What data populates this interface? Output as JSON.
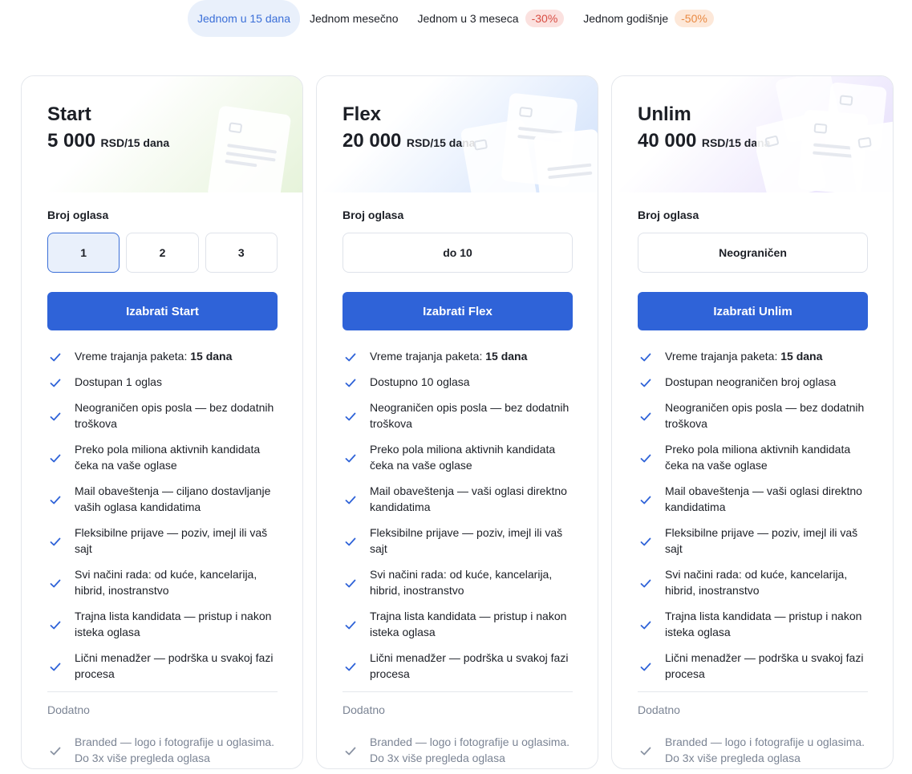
{
  "periods": [
    {
      "label": "Jednom u 15 dana",
      "badge": ""
    },
    {
      "label": "Jednom mesečno",
      "badge": ""
    },
    {
      "label": "Jednom u 3 meseca",
      "badge": "-30%"
    },
    {
      "label": "Jednom godišnje",
      "badge": "-50%"
    }
  ],
  "selected_period": "Jednom u 15 dana",
  "colors": {
    "accent": "#2f63d8",
    "badge_red": "#d84d43",
    "badge_orange": "#e98a43"
  },
  "plans": [
    {
      "name": "Start",
      "price": "5 000",
      "unit": "RSD/15 dana",
      "ads_label": "Broj oglasa",
      "options": [
        "1",
        "2",
        "3"
      ],
      "selected_option": "1",
      "cta": "Izabrati Start",
      "features": {
        "f1_prefix": "Vreme trajanja paketa: ",
        "f1_bold": "15 dana",
        "f2": "Dostupan 1 oglas",
        "f3": "Neograničen opis posla — bez dodatnih troškova",
        "f4": "Preko pola miliona aktivnih kandidata čeka na vaše oglase",
        "f5": "Mail obaveštenja — ciljano dostavljanje vaših oglasa kandidatima",
        "f6": "Fleksibilne prijave — poziv, imejl ili vaš sajt",
        "f7": "Svi načini rada: od kuće, kancelarija, hibrid, inostranstvo",
        "f8": "Trajna lista kandidata — pristup i nakon isteka oglasa",
        "f9": "Lični menadžer — podrška u svakoj fazi procesa"
      },
      "extra_label": "Dodatno",
      "extra": "Branded — logo i fotografije u oglasima. Do 3x više pregleda oglasa"
    },
    {
      "name": "Flex",
      "price": "20 000",
      "unit": "RSD/15 dana",
      "ads_label": "Broj oglasa",
      "options": [
        "do 10"
      ],
      "selected_option": "do 10",
      "cta": "Izabrati Flex",
      "features": {
        "f1_prefix": "Vreme trajanja paketa: ",
        "f1_bold": "15 dana",
        "f2": "Dostupno 10 oglasa",
        "f3": "Neograničen opis posla — bez dodatnih troškova",
        "f4": "Preko pola miliona aktivnih kandidata čeka na vaše oglase",
        "f5": "Mail obaveštenja — vaši oglasi direktno kandidatima",
        "f6": "Fleksibilne prijave — poziv, imejl ili vaš sajt",
        "f7": "Svi načini rada: od kuće, kancelarija, hibrid, inostranstvo",
        "f8": "Trajna lista kandidata — pristup i nakon isteka oglasa",
        "f9": "Lični menadžer — podrška u svakoj fazi procesa"
      },
      "extra_label": "Dodatno",
      "extra": "Branded — logo i fotografije u oglasima. Do 3x više pregleda oglasa"
    },
    {
      "name": "Unlim",
      "price": "40 000",
      "unit": "RSD/15 dana",
      "ads_label": "Broj oglasa",
      "options": [
        "Neograničen"
      ],
      "selected_option": "Neograničen",
      "cta": "Izabrati Unlim",
      "features": {
        "f1_prefix": "Vreme trajanja paketa: ",
        "f1_bold": "15 dana",
        "f2": "Dostupan neograničen broj oglasa",
        "f3": "Neograničen opis posla — bez dodatnih troškova",
        "f4": "Preko pola miliona aktivnih kandidata čeka na vaše oglase",
        "f5": "Mail obaveštenja — vaši oglasi direktno kandidatima",
        "f6": "Fleksibilne prijave — poziv, imejl ili vaš sajt",
        "f7": "Svi načini rada: od kuće, kancelarija, hibrid, inostranstvo",
        "f8": "Trajna lista kandidata — pristup i nakon isteka oglasa",
        "f9": "Lični menadžer — podrška u svakoj fazi procesa"
      },
      "extra_label": "Dodatno",
      "extra": "Branded — logo i fotografije u oglasima. Do 3x više pregleda oglasa"
    }
  ]
}
